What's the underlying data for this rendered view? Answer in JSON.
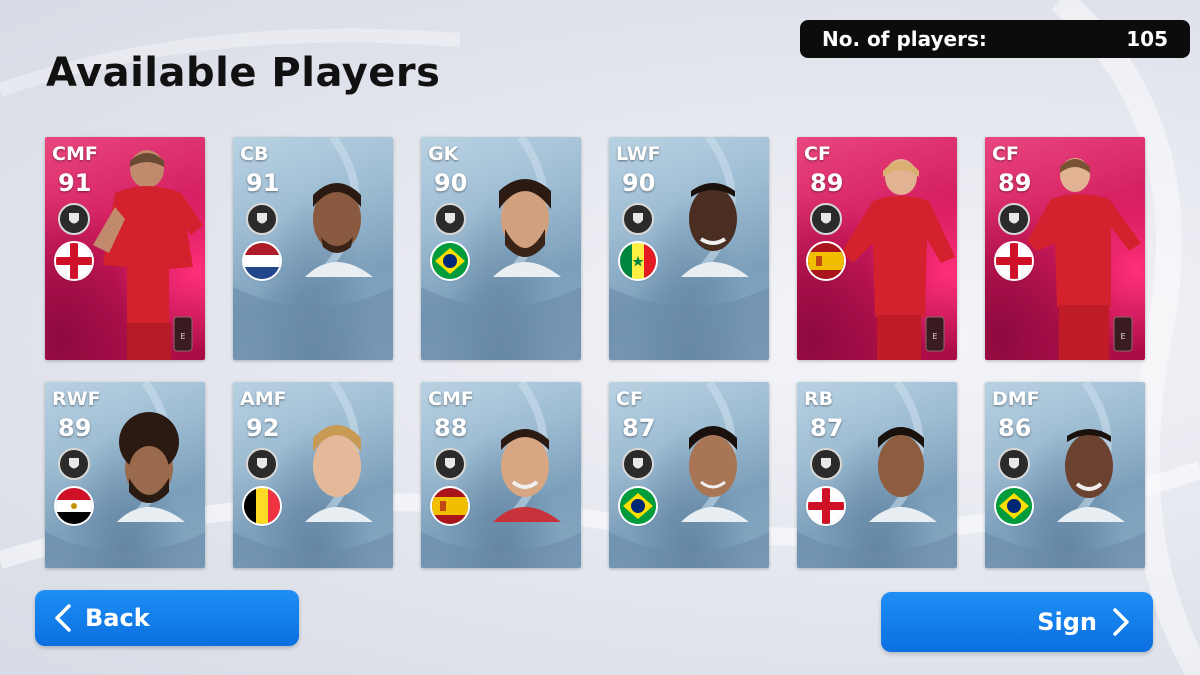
{
  "screen": {
    "title": "Available Players",
    "counter_label": "No. of players:",
    "counter_value": "105"
  },
  "players": [
    {
      "position": "CMF",
      "rating": "91",
      "nation": "England",
      "card": "pink",
      "tier": "epic"
    },
    {
      "position": "CB",
      "rating": "91",
      "nation": "Netherlands",
      "card": "blue"
    },
    {
      "position": "GK",
      "rating": "90",
      "nation": "Brazil",
      "card": "blue"
    },
    {
      "position": "LWF",
      "rating": "90",
      "nation": "Senegal",
      "card": "blue"
    },
    {
      "position": "CF",
      "rating": "89",
      "nation": "Spain",
      "card": "pink",
      "tier": "epic"
    },
    {
      "position": "CF",
      "rating": "89",
      "nation": "England",
      "card": "pink",
      "tier": "epic"
    },
    {
      "position": "RWF",
      "rating": "89",
      "nation": "Egypt",
      "card": "blue"
    },
    {
      "position": "AMF",
      "rating": "92",
      "nation": "Belgium",
      "card": "blue"
    },
    {
      "position": "CMF",
      "rating": "88",
      "nation": "Spain",
      "card": "blue"
    },
    {
      "position": "CF",
      "rating": "87",
      "nation": "Brazil",
      "card": "blue"
    },
    {
      "position": "RB",
      "rating": "87",
      "nation": "England",
      "card": "blue"
    },
    {
      "position": "DMF",
      "rating": "86",
      "nation": "Brazil",
      "card": "blue"
    }
  ],
  "buttons": {
    "back_label": "Back",
    "sign_label": "Sign"
  },
  "colors": {
    "button_blue": "#0b6fe0",
    "card_blue": "#9dbcd2",
    "card_pink": "#d21b5e",
    "counter_bg": "#0c0c0c"
  }
}
